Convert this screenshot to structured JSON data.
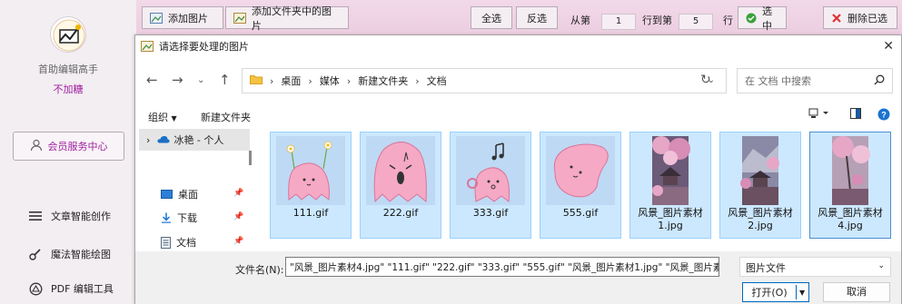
{
  "app": {
    "name": "首助编辑高手",
    "tagline": "不加糖",
    "member_label": "会员服务中心",
    "nav": [
      {
        "label": "文章智能创作",
        "icon": "menu-lines-icon"
      },
      {
        "label": "魔法智能绘图",
        "icon": "brush-icon"
      },
      {
        "label": "PDF 编辑工具",
        "icon": "pdf-icon"
      }
    ],
    "accent": "#a020a0"
  },
  "toolbar": {
    "add_images": "添加图片",
    "add_folder_images": "添加文件夹中的图片",
    "select_all": "全选",
    "invert": "反选",
    "from_label": "从第",
    "from_value": "1",
    "to_label": "行到第",
    "to_value": "5",
    "row_label": "行",
    "select_label": "选中",
    "delete_selected": "删除已选"
  },
  "dialog": {
    "title": "请选择要处理的图片",
    "breadcrumb": [
      "桌面",
      "媒体",
      "新建文件夹",
      "文档"
    ],
    "search_placeholder": "在 文档 中搜索",
    "organize": "组织",
    "new_folder": "新建文件夹",
    "tree": {
      "root": "冰艳 - 个人",
      "items": [
        {
          "label": "桌面",
          "icon": "desktop-icon"
        },
        {
          "label": "下载",
          "icon": "download-icon"
        },
        {
          "label": "文档",
          "icon": "document-icon"
        }
      ]
    },
    "files": [
      {
        "name": "111.gif",
        "kind": "ghost-flowers"
      },
      {
        "name": "222.gif",
        "kind": "ghost-shout"
      },
      {
        "name": "333.gif",
        "kind": "ghost-music"
      },
      {
        "name": "555.gif",
        "kind": "ghost-blob"
      },
      {
        "name": "风景_图片素材1.jpg",
        "kind": "landscape"
      },
      {
        "name": "风景_图片素材2.jpg",
        "kind": "landscape"
      },
      {
        "name": "风景_图片素材4.jpg",
        "kind": "landscape"
      }
    ],
    "filename_label": "文件名(N):",
    "filename_value": "\"风景_图片素材4.jpg\" \"111.gif\" \"222.gif\" \"333.gif\" \"555.gif\" \"风景_图片素材1.jpg\" \"风景_图片素材2.jpg\"",
    "filetype": "图片文件",
    "open": "打开(O)",
    "cancel": "取消"
  }
}
